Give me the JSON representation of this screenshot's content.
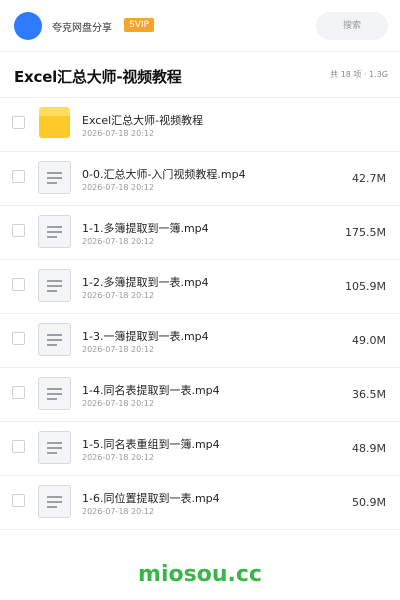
{
  "header": {
    "uploader": "夸克网盘分享",
    "badge": "SVIP",
    "search_label": "搜索",
    "avatar_color": "#2f7bff",
    "badge_color": "#f7a42d"
  },
  "folder": {
    "title": "Excel汇总大师-视频教程",
    "meta": "共 18 项 · 1.3G"
  },
  "files": [
    {
      "name": "Excel汇总大师-视频教程",
      "date": "2026-07-18 20:12",
      "size": "",
      "icon": "folder-icon"
    },
    {
      "name": "0-0.汇总大师-入门视频教程.mp4",
      "date": "2026-07-18 20:12",
      "size": "42.7M",
      "icon": "file-icon"
    },
    {
      "name": "1-1.多簿提取到一簿.mp4",
      "date": "2026-07-18 20:12",
      "size": "175.5M",
      "icon": "file-icon"
    },
    {
      "name": "1-2.多簿提取到一表.mp4",
      "date": "2026-07-18 20:12",
      "size": "105.9M",
      "icon": "file-icon"
    },
    {
      "name": "1-3.一簿提取到一表.mp4",
      "date": "2026-07-18 20:12",
      "size": "49.0M",
      "icon": "file-icon"
    },
    {
      "name": "1-4.同名表提取到一表.mp4",
      "date": "2026-07-18 20:12",
      "size": "36.5M",
      "icon": "file-icon"
    },
    {
      "name": "1-5.同名表重组到一簿.mp4",
      "date": "2026-07-18 20:12",
      "size": "48.9M",
      "icon": "file-icon"
    },
    {
      "name": "1-6.同位置提取到一表.mp4",
      "date": "2026-07-18 20:12",
      "size": "50.9M",
      "icon": "file-icon"
    }
  ],
  "watermark": "miosou.cc"
}
